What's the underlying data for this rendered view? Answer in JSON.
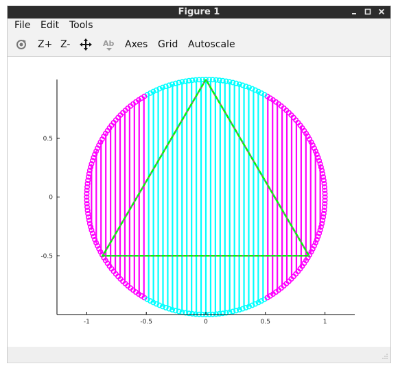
{
  "window": {
    "title": "Figure 1"
  },
  "menu": {
    "file": "File",
    "edit": "Edit",
    "tools": "Tools"
  },
  "toolbar": {
    "zoom_in": "Z+",
    "zoom_out": "Z-",
    "axes": "Axes",
    "grid": "Grid",
    "autoscale": "Autoscale"
  },
  "icons": [
    "rotate-icon",
    "pan-icon",
    "text-icon",
    "minimize-icon",
    "maximize-icon",
    "close-icon",
    "resize-grip-icon"
  ],
  "chart_data": {
    "type": "line",
    "title": "",
    "xlabel": "",
    "ylabel": "",
    "xlim": [
      -1.25,
      1.25
    ],
    "ylim": [
      -1,
      1
    ],
    "xticks": [
      "-1",
      "-0.5",
      "0",
      "0.5",
      "1"
    ],
    "yticks": [
      "-0.5",
      "0",
      "0.5"
    ],
    "grid": false,
    "circle": {
      "radius": 1,
      "center": [
        0,
        0
      ]
    },
    "triangle_vertices": [
      [
        0,
        1
      ],
      [
        -0.866,
        -0.5
      ],
      [
        0.866,
        -0.5
      ],
      [
        0,
        1
      ]
    ],
    "stem_spacing": 0.04,
    "stem_x_range": [
      -1,
      1
    ],
    "series": [
      {
        "color": "#ff00ff",
        "x_range": [
          -1,
          -0.5
        ]
      },
      {
        "color": "#00ffff",
        "x_range": [
          -0.5,
          0.5
        ]
      },
      {
        "color": "#ff00ff",
        "x_range": [
          0.5,
          1
        ]
      }
    ],
    "colors": {
      "magenta": "#ff00ff",
      "cyan": "#00ffff",
      "triangle_green": "#00ff00",
      "triangle_gray": "#808080"
    }
  }
}
